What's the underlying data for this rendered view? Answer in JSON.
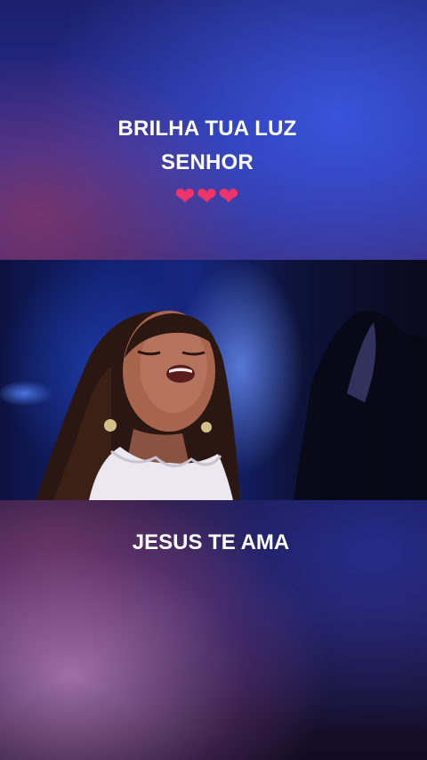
{
  "top_caption": {
    "line1": "BRILHA TUA LUZ",
    "line2": "SENHOR",
    "hearts": "❤❤❤"
  },
  "video": {
    "subject": "woman singing with eyes closed"
  },
  "bottom_caption": {
    "text": "JESUS TE AMA"
  },
  "colors": {
    "heart": "#f0346a",
    "caption_text": "#ffffff",
    "top_background_blue": "#2a2f9a",
    "video_blue": "#17267e"
  }
}
